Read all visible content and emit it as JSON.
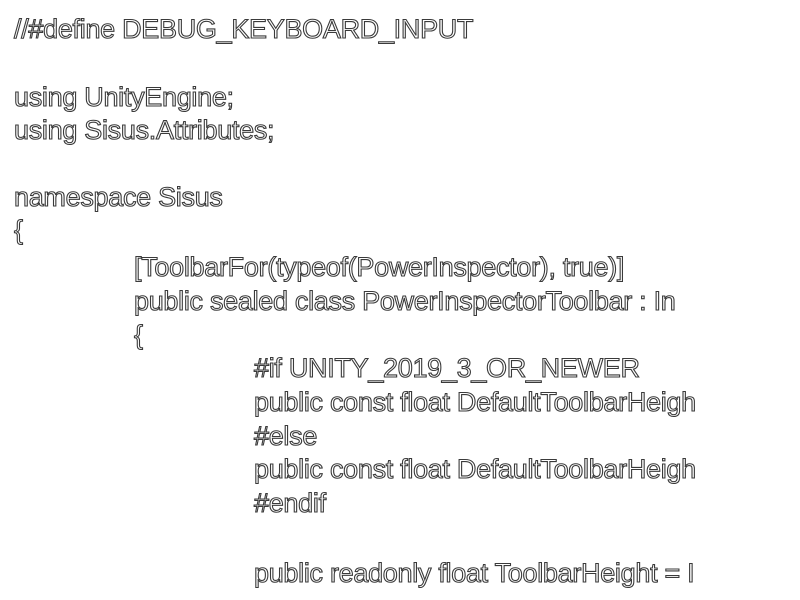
{
  "editor": {
    "lines": [
      "//#define DEBUG_KEYBOARD_INPUT",
      "",
      "using UnityEngine;",
      "using Sisus.Attributes;",
      "",
      "namespace Sisus",
      "{",
      "[ToolbarFor(typeof(PowerInspector), true)]",
      "public sealed class PowerInspectorToolbar : In",
      "{",
      "#if UNITY_2019_3_OR_NEWER",
      "public const float DefaultToolbarHeigh",
      "#else",
      "public const float DefaultToolbarHeigh",
      "#endif",
      "",
      "public readonly float ToolbarHeight = I"
    ]
  },
  "colors": {
    "background": "#ffffff",
    "text_fill": "#ffffff",
    "text_outline": "#3a3a3a"
  }
}
